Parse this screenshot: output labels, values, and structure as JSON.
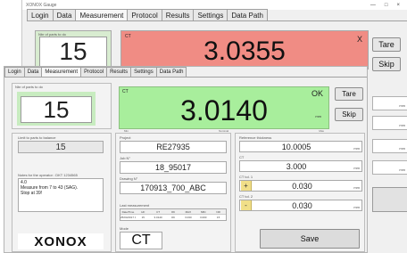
{
  "back_window": {
    "title": "XONOX Gauge",
    "window_controls": [
      "—",
      "□",
      "×"
    ],
    "tabs": [
      "Login",
      "Data",
      "Measurement",
      "Protocol",
      "Results",
      "Settings",
      "Data Path"
    ],
    "part_count_label": "Nbr of parts to do",
    "part_count": "15",
    "measurement_label": "CT",
    "measurement_value": "3.0355",
    "status_mark": "X",
    "tare_label": "Tare",
    "skip_label": "Skip",
    "side_units": [
      "mm",
      "mm",
      "mm",
      "mm"
    ],
    "colors": {
      "measurement_bg": "#f08c84"
    }
  },
  "front_window": {
    "tabs": [
      "Login",
      "Data",
      "Measurement",
      "Protocol",
      "Results",
      "Settings",
      "Data Path"
    ],
    "part_count_label": "Nbr of parts to do",
    "part_count": "15",
    "measurement_label": "CT",
    "measurement_value": "3.0140",
    "status": "OK",
    "measurement_unit": "mm",
    "scale_labels": [
      "Min",
      "Nominal",
      "Max"
    ],
    "tare_label": "Tare",
    "skip_label": "Skip",
    "gauge_label": "Limit to parts to balance",
    "gauge_value": "15",
    "notes_label": "Notes for the operator : DKT 1234565",
    "notes_lines": [
      "4.0",
      "Measure from 7 to 43 (SAG).",
      "Stop at 39!"
    ],
    "logo_text": "XONOX",
    "project_label": "Project",
    "project_value": "RE27935",
    "job_label": "Job N°",
    "job_value": "18_95017",
    "drawing_label": "Drawing N°",
    "drawing_value": "170913_700_ABC",
    "last_measurement_label": "Last measurement",
    "last_table_headers": [
      "Date/Time",
      "HF",
      "CT",
      "OK",
      "MAX",
      "MIN",
      "NR"
    ],
    "last_table_row": [
      "25/04/2017 08:19",
      "15",
      "3.0140",
      "OK",
      "3.030",
      "3.000",
      "15"
    ],
    "mode_label": "Mode",
    "mode_value": "CT",
    "reference_thickness_label": "Reference thickness",
    "reference_thickness_value": "10.0005",
    "reference_unit": "mm",
    "ct_label": "CT",
    "ct_value": "3.000",
    "ct_unit": "mm",
    "ct_tol1_label": "CT tol. 1",
    "ct_tol1_sign": "+",
    "ct_tol1_value": "0.030",
    "ct_tol1_unit": "mm",
    "ct_tol2_label": "CT tol. 2",
    "ct_tol2_sign": "-",
    "ct_tol2_value": "0.030",
    "ct_tol2_unit": "mm",
    "save_label": "Save",
    "colors": {
      "measurement_bg": "#a8ee9c",
      "tolerance_sign_bg": "#f1df88"
    }
  }
}
